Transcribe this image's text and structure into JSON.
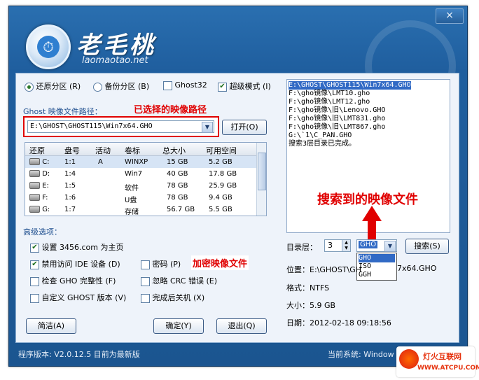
{
  "window": {
    "close_icon": "×",
    "logo_text": "老毛桃",
    "logo_url": "laomaotao.net"
  },
  "mode": {
    "restore_label": "还原分区",
    "restore_key": "(R)",
    "backup_label": "备份分区",
    "backup_key": "(B)",
    "ghost32_label": "Ghost32",
    "super_label": "超级模式",
    "super_key": "(I)"
  },
  "path": {
    "label": "Ghost 映像文件路径：",
    "annotation": "已选择的映像路径",
    "value": "E:\\GHOST\\GHOST115\\Win7x64.GHO",
    "open_button": "打开(O)"
  },
  "table": {
    "headers": [
      "还原",
      "盘号",
      "活动",
      "卷标",
      "总大小",
      "可用空间"
    ],
    "rows": [
      {
        "drive": "C:",
        "num": "1:1",
        "active": "A",
        "label": "WINXP",
        "total": "15 GB",
        "free": "5.2 GB"
      },
      {
        "drive": "D:",
        "num": "1:4",
        "active": "",
        "label": "Win7",
        "total": "40 GB",
        "free": "17.8 GB"
      },
      {
        "drive": "E:",
        "num": "1:5",
        "active": "",
        "label": "软件",
        "total": "78 GB",
        "free": "25.9 GB"
      },
      {
        "drive": "F:",
        "num": "1:6",
        "active": "",
        "label": "U盘",
        "total": "78 GB",
        "free": "9.4 GB"
      },
      {
        "drive": "G:",
        "num": "1:7",
        "active": "",
        "label": "存储",
        "total": "56.7 GB",
        "free": "5.5 GB"
      }
    ]
  },
  "advanced": {
    "title": "高级选项：",
    "set_home": "设置 3456.com 为主页",
    "disable_ide": "禁用访问 IDE 设备",
    "disable_ide_key": "(D)",
    "password": "密码",
    "password_key": "(P)",
    "encrypt_annotation": "加密映像文件",
    "check_gho": "检查 GHO 完整性",
    "check_gho_key": "(F)",
    "ignore_crc": "忽略 CRC 错误",
    "ignore_crc_key": "(E)",
    "custom_ghost": "自定义 GHOST 版本",
    "custom_ghost_key": "(V)",
    "shutdown": "完成后关机",
    "shutdown_key": "(X)"
  },
  "buttons": {
    "simple": "简洁(A)",
    "ok": "确定(Y)",
    "exit": "退出(Q)"
  },
  "results": {
    "lines": [
      "E:\\GHOST\\GHOST115\\Win7x64.GHO",
      "F:\\gho镜像\\LMT10.gho",
      "F:\\gho镜像\\LMT12.gho",
      "F:\\gho镜像\\旧\\Lenovo.GHO",
      "F:\\gho镜像\\旧\\LMT831.gho",
      "F:\\gho镜像\\旧\\LMT867.gho",
      "G:\\`1\\C_PAN.GHO",
      "搜索3层目录已完成。"
    ],
    "annotation": "搜索到的映像文件"
  },
  "search": {
    "depth_label": "目录层：",
    "depth_value": "3",
    "type_value": "GHO",
    "type_options": [
      "GHO",
      "ISO",
      "GGH"
    ],
    "search_button": "搜索(S)"
  },
  "info": {
    "location_label": "位置：",
    "location_value_a": "E:\\GHOST\\GH",
    "location_value_b": "7x64.GHO",
    "format_label": "格式：",
    "format_value": "NTFS",
    "size_label": "大小：",
    "size_value": "5.9 GB",
    "date_label": "日期：",
    "date_value": "2012-02-18   09:18:56"
  },
  "footer": {
    "version": "程序版本: V2.0.12.5  目前为最新版",
    "system": "当前系统: Window"
  },
  "watermark": {
    "name": "灯火互联网",
    "url": "WWW.ATCPU.COM"
  }
}
